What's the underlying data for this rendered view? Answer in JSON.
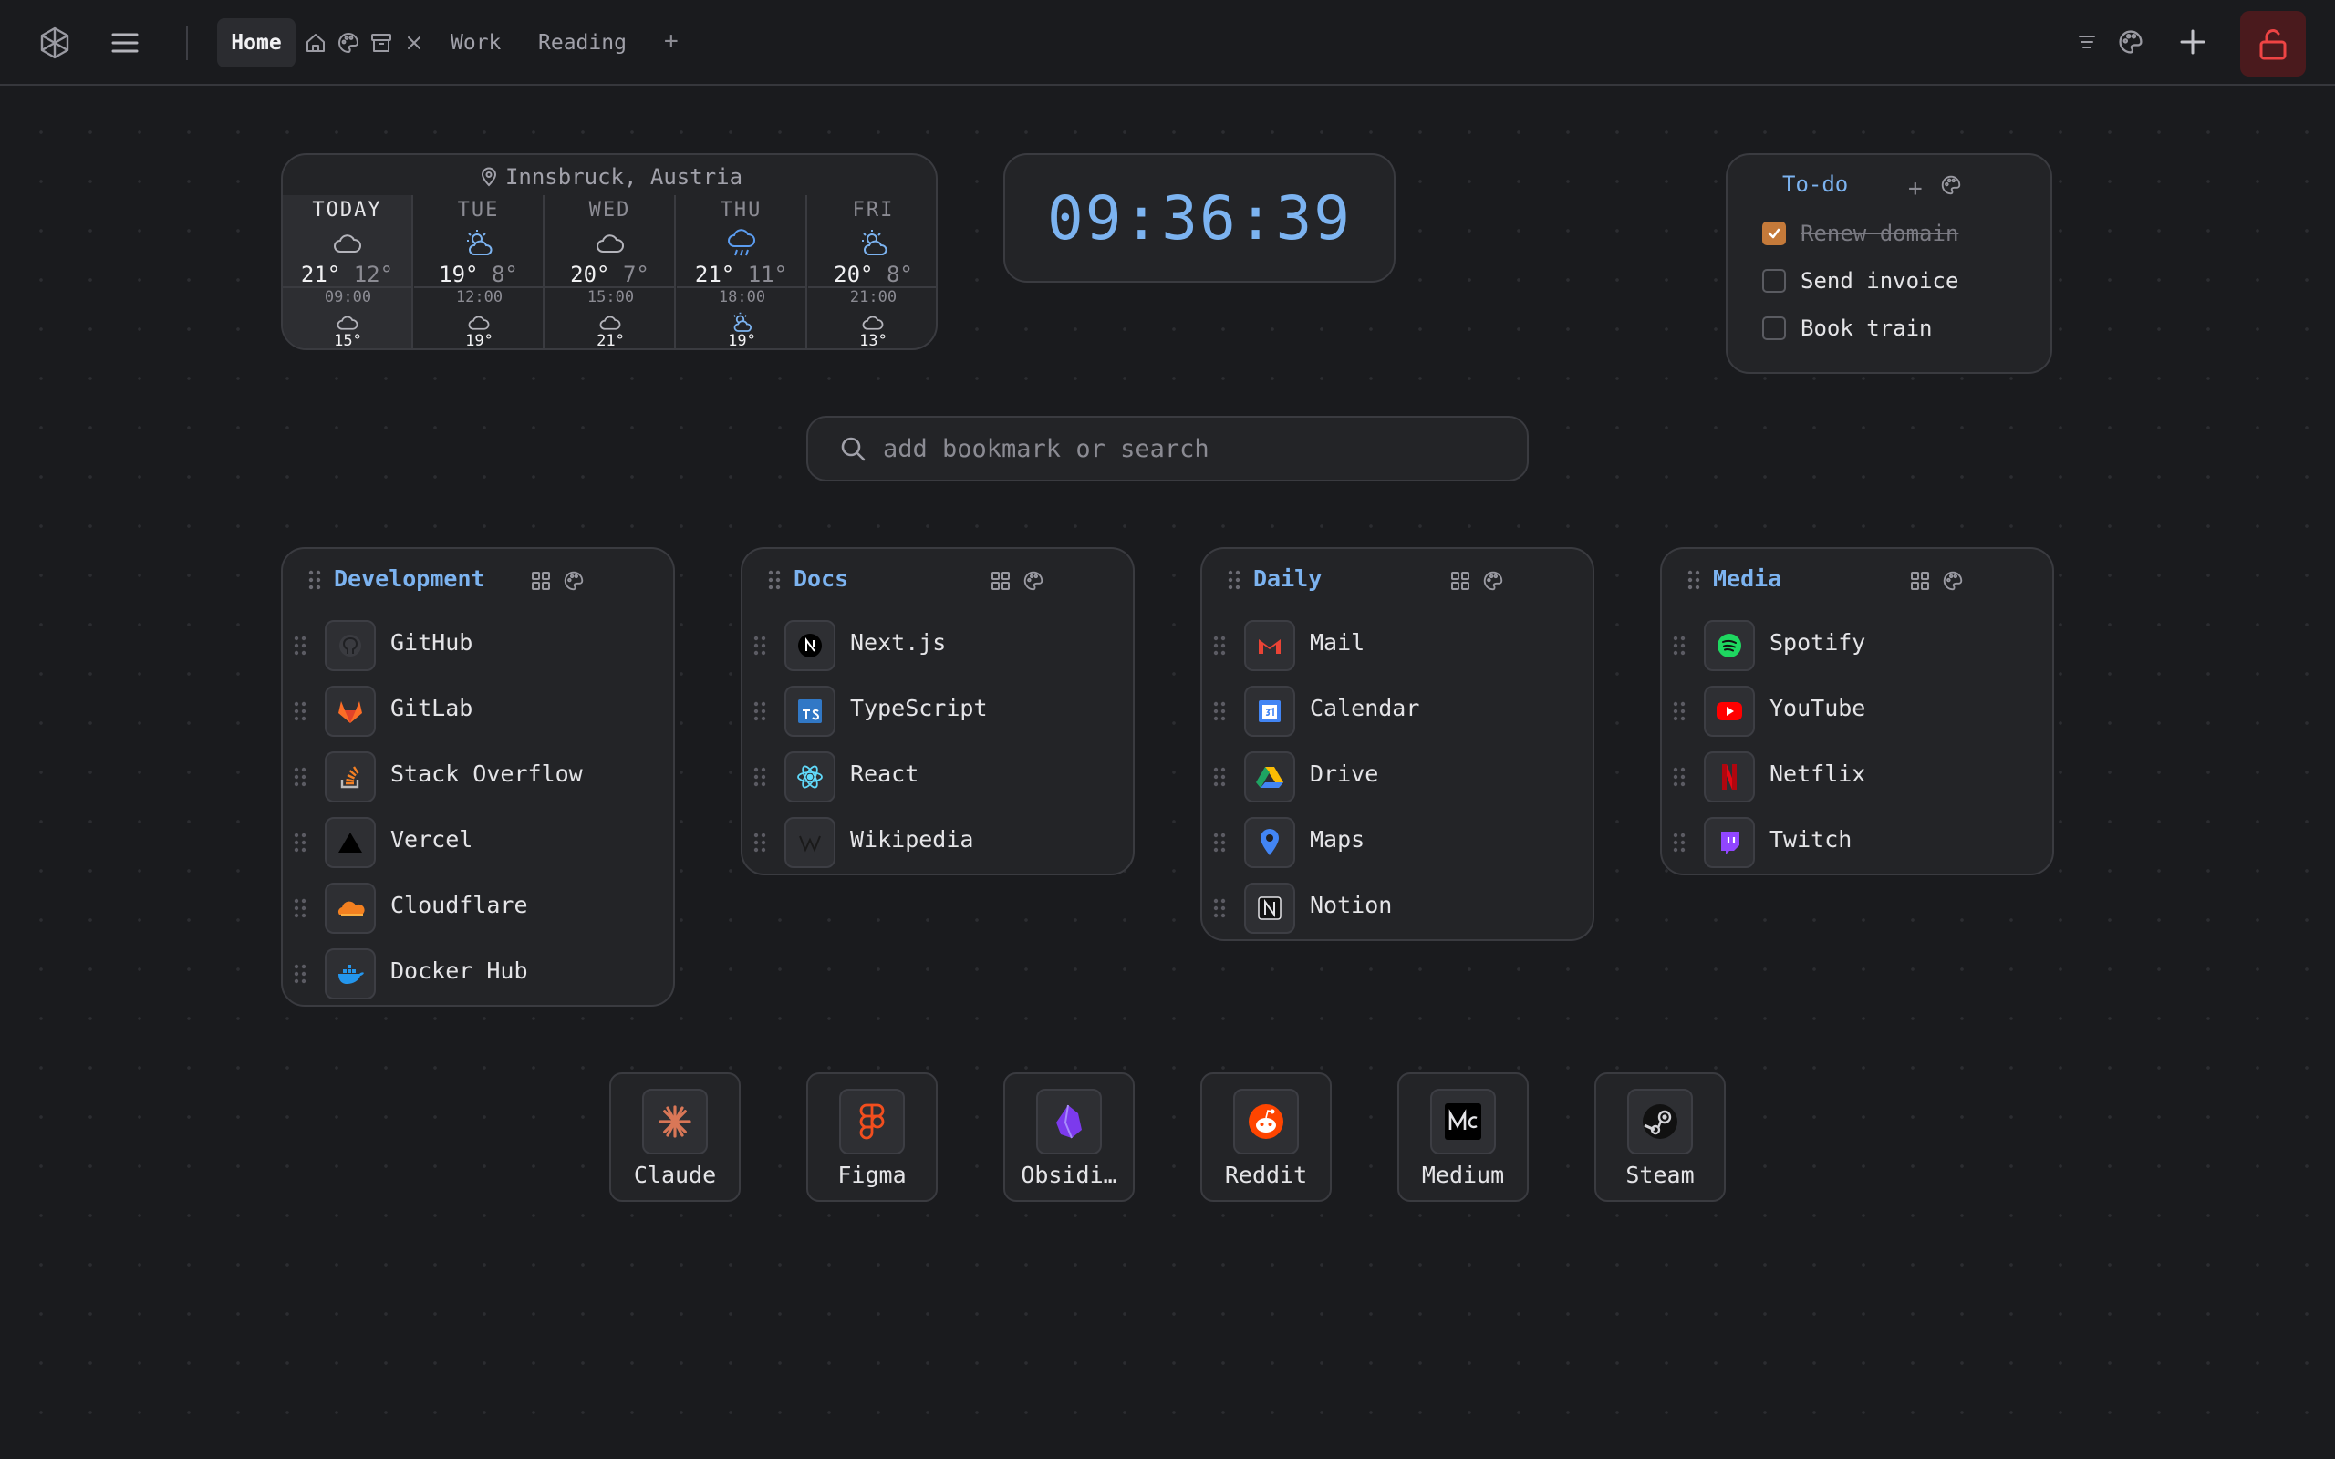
{
  "topbar": {
    "tabs": [
      {
        "label": "Home",
        "active": true
      },
      {
        "label": "Work"
      },
      {
        "label": "Reading"
      }
    ],
    "add_tab": "+"
  },
  "weather": {
    "location": "Innsbruck, Austria",
    "days": [
      {
        "day": "TODAY",
        "icon": "cloud-icon",
        "high": "21°",
        "low": "12°",
        "hour": "09:00",
        "hour_icon": "cloud-icon",
        "hour_temp": "15°"
      },
      {
        "day": "TUE",
        "icon": "partly-sunny-icon",
        "high": "19°",
        "low": "8°",
        "hour": "12:00",
        "hour_icon": "cloud-icon",
        "hour_temp": "19°"
      },
      {
        "day": "WED",
        "icon": "cloud-icon",
        "high": "20°",
        "low": "7°",
        "hour": "15:00",
        "hour_icon": "cloud-icon",
        "hour_temp": "21°"
      },
      {
        "day": "THU",
        "icon": "rain-icon",
        "high": "21°",
        "low": "11°",
        "hour": "18:00",
        "hour_icon": "partly-sunny-icon",
        "hour_temp": "19°"
      },
      {
        "day": "FRI",
        "icon": "partly-sunny-icon",
        "high": "20°",
        "low": "8°",
        "hour": "21:00",
        "hour_icon": "cloud-icon",
        "hour_temp": "13°"
      }
    ]
  },
  "clock": {
    "time": "09:36:39"
  },
  "todo": {
    "title": "To-do",
    "add": "+",
    "items": [
      {
        "label": "Renew domain",
        "done": true
      },
      {
        "label": "Send invoice",
        "done": false
      },
      {
        "label": "Book train",
        "done": false
      }
    ]
  },
  "search": {
    "placeholder": "add bookmark or search"
  },
  "groups": [
    {
      "title": "Development",
      "items": [
        "GitHub",
        "GitLab",
        "Stack Overflow",
        "Vercel",
        "Cloudflare",
        "Docker Hub"
      ]
    },
    {
      "title": "Docs",
      "items": [
        "Next.js",
        "TypeScript",
        "React",
        "Wikipedia"
      ]
    },
    {
      "title": "Daily",
      "items": [
        "Mail",
        "Calendar",
        "Drive",
        "Maps",
        "Notion"
      ]
    },
    {
      "title": "Media",
      "items": [
        "Spotify",
        "YouTube",
        "Netflix",
        "Twitch"
      ]
    }
  ],
  "dock": [
    "Claude",
    "Figma",
    "Obsidi…",
    "Reddit",
    "Medium",
    "Steam"
  ],
  "colors": {
    "accent": "#7cb3f0",
    "lock": "#ef4444",
    "checkbox": "#c57a3a"
  }
}
